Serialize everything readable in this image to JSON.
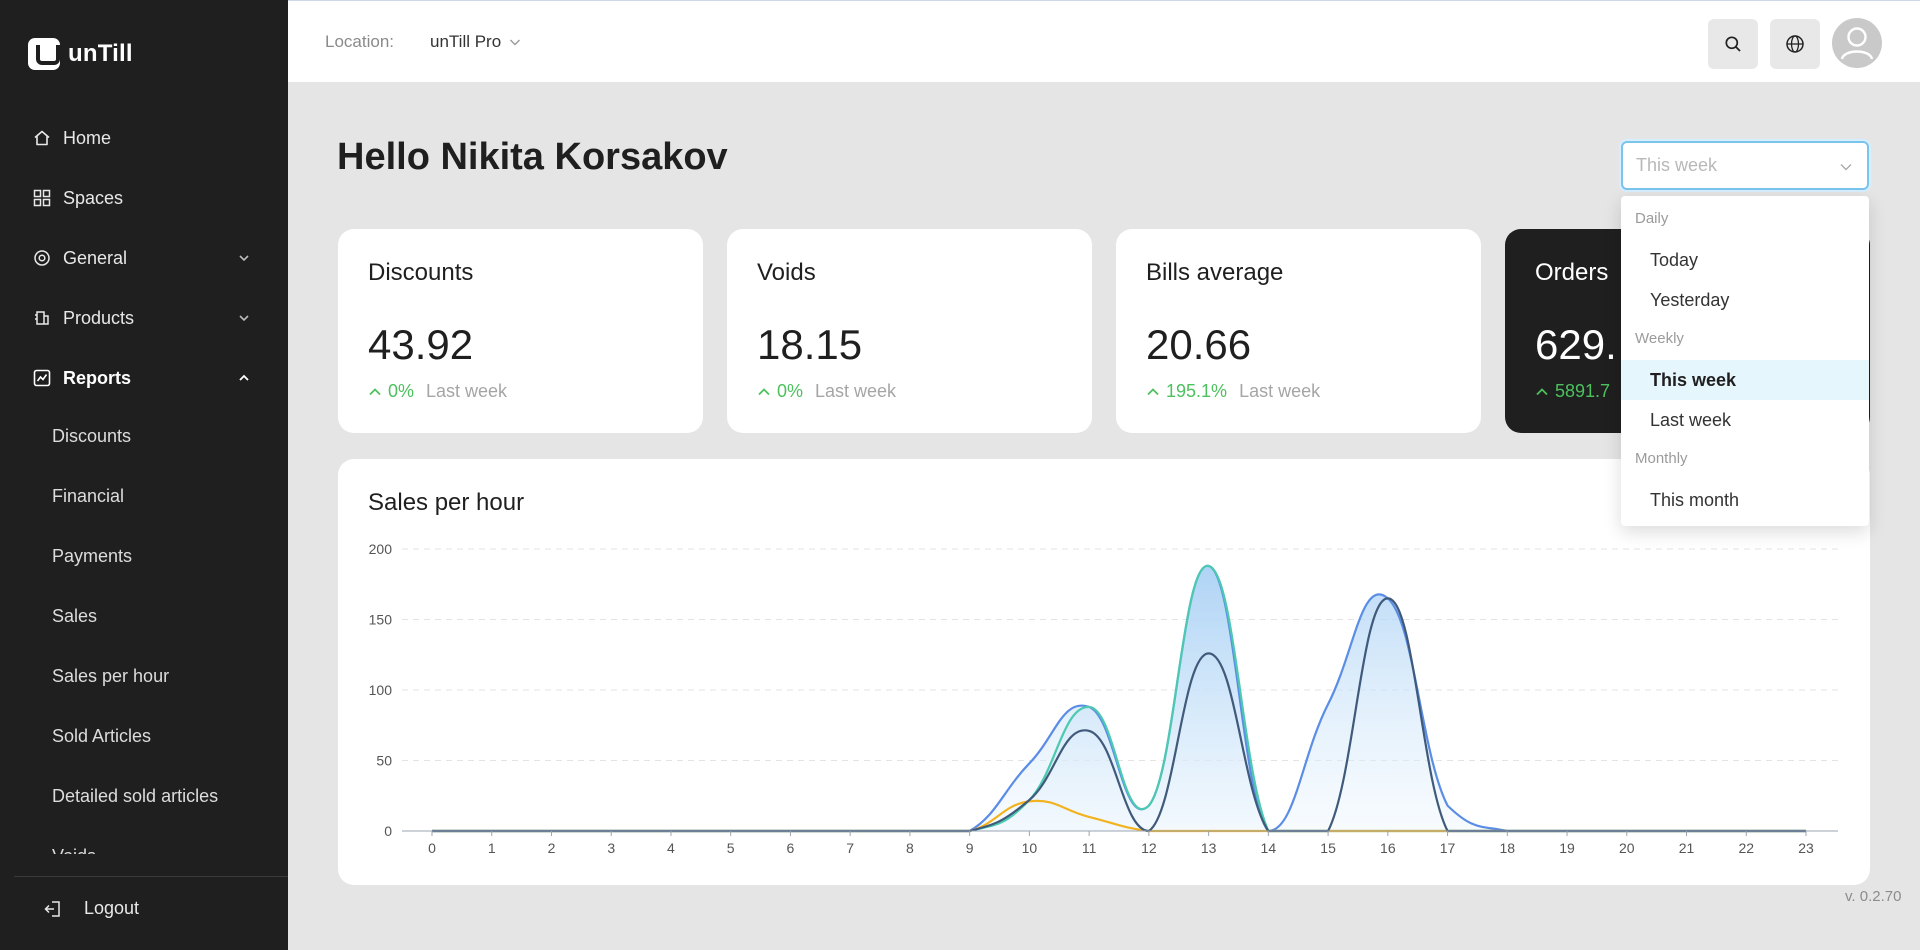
{
  "app": {
    "name": "unTill",
    "version": "v. 0.2.70"
  },
  "sidebar": {
    "items": [
      {
        "label": "Home",
        "icon": "home-icon"
      },
      {
        "label": "Spaces",
        "icon": "grid-icon"
      },
      {
        "label": "General",
        "icon": "settings-icon"
      },
      {
        "label": "Products",
        "icon": "products-icon"
      },
      {
        "label": "Reports",
        "icon": "chart-icon"
      }
    ],
    "reports_sub": [
      "Discounts",
      "Financial",
      "Payments",
      "Sales",
      "Sales per hour",
      "Sold Articles",
      "Detailed sold articles",
      "Voids"
    ],
    "logout": "Logout"
  },
  "header": {
    "location_label": "Location:",
    "location_value": "unTill Pro"
  },
  "greeting": "Hello Nikita Korsakov",
  "cards": [
    {
      "title": "Discounts",
      "value": "43.92",
      "delta": "0%",
      "ref": "Last week"
    },
    {
      "title": "Voids",
      "value": "18.15",
      "delta": "0%",
      "ref": "Last week"
    },
    {
      "title": "Bills average",
      "value": "20.66",
      "delta": "195.1%",
      "ref": "Last week"
    },
    {
      "title": "Orders",
      "value": "629.",
      "delta": "5891.7",
      "ref": ""
    }
  ],
  "period_select": {
    "placeholder": "This week",
    "groups": [
      {
        "label": "Daily",
        "options": [
          "Today",
          "Yesterday"
        ]
      },
      {
        "label": "Weekly",
        "options": [
          "This week",
          "Last week"
        ]
      },
      {
        "label": "Monthly",
        "options": [
          "This month"
        ]
      }
    ],
    "selected": "This week"
  },
  "colors": {
    "accent_green": "#4cc15e",
    "sidebar_bg": "#1f1f1f",
    "select_border": "#7cc4ec"
  },
  "chart_data": {
    "type": "area",
    "title": "Sales per hour",
    "x": [
      0,
      1,
      2,
      3,
      4,
      5,
      6,
      7,
      8,
      9,
      10,
      11,
      12,
      13,
      14,
      15,
      16,
      17,
      18,
      19,
      20,
      21,
      22,
      23
    ],
    "ylim": [
      0,
      200
    ],
    "yticks": [
      0,
      50,
      100,
      150,
      200
    ],
    "grid": true,
    "series": [
      {
        "color": "#5b8de6",
        "values": [
          0,
          0,
          0,
          0,
          0,
          0,
          0,
          0,
          0,
          0,
          48,
          88,
          18,
          188,
          0,
          90,
          165,
          18,
          0,
          0,
          0,
          0,
          0,
          0
        ]
      },
      {
        "color": "#4cc9b0",
        "values": [
          0,
          0,
          0,
          0,
          0,
          0,
          0,
          0,
          0,
          0,
          22,
          88,
          18,
          188,
          0,
          0,
          0,
          0,
          0,
          0,
          0,
          0,
          0,
          0
        ]
      },
      {
        "color": "#f2b320",
        "values": [
          0,
          0,
          0,
          0,
          0,
          0,
          0,
          0,
          0,
          0,
          21,
          10,
          0,
          0,
          0,
          0,
          0,
          0,
          0,
          0,
          0,
          0,
          0,
          0
        ]
      },
      {
        "color": "#3f5a7a",
        "values": [
          0,
          0,
          0,
          0,
          0,
          0,
          0,
          0,
          0,
          0,
          22,
          71,
          0,
          126,
          0,
          0,
          165,
          0,
          0,
          0,
          0,
          0,
          0,
          0
        ]
      }
    ]
  }
}
